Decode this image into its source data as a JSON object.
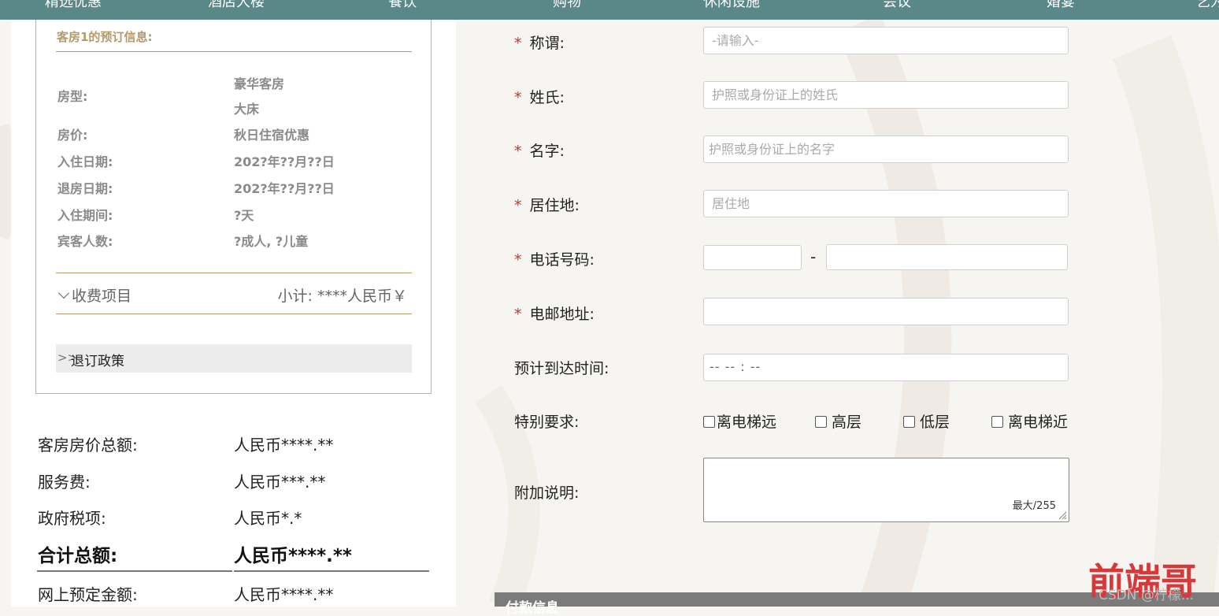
{
  "nav": {
    "items": [
      "精选优惠",
      "酒店大楼",
      "餐饮",
      "购物",
      "休闲设施",
      "会议",
      "婚宴",
      "艺为"
    ]
  },
  "booking": {
    "title": "客房1的预订信息:",
    "rows": [
      {
        "label": "房型:",
        "value": "豪华客房"
      },
      {
        "label": "",
        "value": "大床"
      },
      {
        "label": "房价:",
        "value": "秋日住宿优惠"
      },
      {
        "label": "入住日期:",
        "value": "202?年??月??日"
      },
      {
        "label": "退房日期:",
        "value": "202?年??月??日"
      },
      {
        "label": "入住期间:",
        "value": "?天"
      },
      {
        "label": "宾客人数:",
        "value": "?成人, ?儿童"
      }
    ],
    "fee_toggle_label": "收费项目",
    "subtotal": "小计: ****人民币￥",
    "policy_arrows": ">>",
    "policy_label": "退订政策"
  },
  "summary": {
    "rows": [
      {
        "label": "客房房价总额:",
        "value": "人民币****.**"
      },
      {
        "label": "服务费:",
        "value": "人民币***.**"
      },
      {
        "label": "政府税项:",
        "value": "人民币*.*"
      },
      {
        "label": "合计总额:",
        "value": "人民币****.**"
      },
      {
        "label": "网上预定金额:",
        "value": "人民币****.**"
      }
    ]
  },
  "form": {
    "required_mark": "*",
    "salutation": {
      "label": "称谓:",
      "placeholder": "-请输入-"
    },
    "surname": {
      "label": "姓氏:",
      "placeholder": "护照或身份证上的姓氏"
    },
    "given_name": {
      "label": "名字:",
      "placeholder": "护照或身份证上的名字"
    },
    "residence": {
      "label": "居住地:",
      "placeholder": "居住地"
    },
    "phone": {
      "label": "电话号码:",
      "separator": "-"
    },
    "email": {
      "label": "电邮地址:"
    },
    "arrival": {
      "label": "预计到达时间:",
      "value": "-- -- : --"
    },
    "requests": {
      "label": "特别要求:",
      "options": [
        "离电梯远",
        "高层",
        "低层",
        "离电梯近"
      ]
    },
    "notes": {
      "label": "附加说明:",
      "counter": "最大/255"
    }
  },
  "payment": {
    "title": "付款信息"
  },
  "watermark": {
    "logo": "前端哥",
    "text": "CSDN @柠檬..."
  }
}
